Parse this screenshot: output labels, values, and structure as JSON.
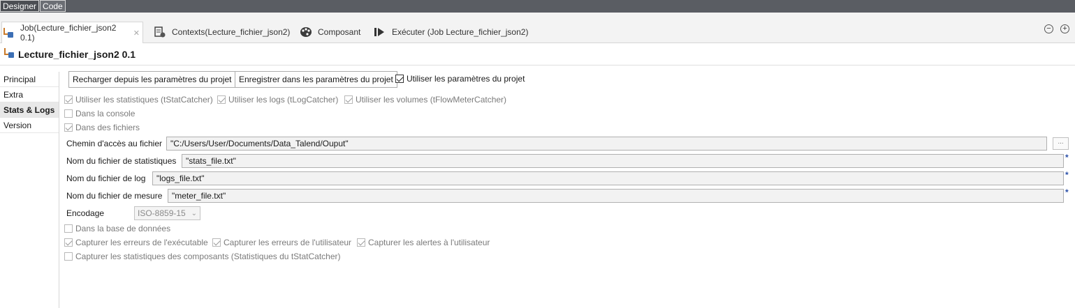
{
  "topbar": {
    "designer": "Designer",
    "code": "Code"
  },
  "tabs": [
    {
      "label": "Job(Lecture_fichier_json2 0.1)",
      "close": "✕"
    },
    {
      "label": "Contexts(Lecture_fichier_json2)"
    },
    {
      "label": "Composant"
    },
    {
      "label": "Exécuter (Job Lecture_fichier_json2)"
    }
  ],
  "tab_controls": {
    "minimize": "−",
    "maximize": "+"
  },
  "title": "Lecture_fichier_json2 0.1",
  "leftnav": [
    "Principal",
    "Extra",
    "Stats & Logs",
    "Version"
  ],
  "buttons": {
    "reload": "Recharger depuis les paramètres du projet",
    "save": "Enregistrer dans les paramètres du projet"
  },
  "checkboxes": {
    "use_project_settings": "Utiliser les paramètres du projet",
    "use_stats": "Utiliser les statistiques (tStatCatcher)",
    "use_logs": "Utiliser les logs (tLogCatcher)",
    "use_volumes": "Utiliser les volumes (tFlowMeterCatcher)",
    "console": "Dans la console",
    "files": "Dans des fichiers",
    "database": "Dans la base de données",
    "capture_exec_errors": "Capturer les erreurs de l'exécutable",
    "capture_user_errors": "Capturer les erreurs de l'utilisateur",
    "capture_user_alerts": "Capturer les alertes à l'utilisateur",
    "capture_component_stats": "Capturer les statistiques des composants (Statistiques du tStatCatcher)"
  },
  "fields": {
    "path_label": "Chemin d'accès au fichier",
    "path_value": "\"C:/Users/User/Documents/Data_Talend/Ouput\"",
    "stats_label": "Nom du fichier de statistiques",
    "stats_value": "\"stats_file.txt\"",
    "log_label": "Nom du fichier de log",
    "log_value": "\"logs_file.txt\"",
    "meter_label": "Nom du fichier de mesure",
    "meter_value": "\"meter_file.txt\"",
    "encoding_label": "Encodage",
    "encoding_value": "ISO-8859-15",
    "required_mark": "*",
    "browse": "..."
  }
}
